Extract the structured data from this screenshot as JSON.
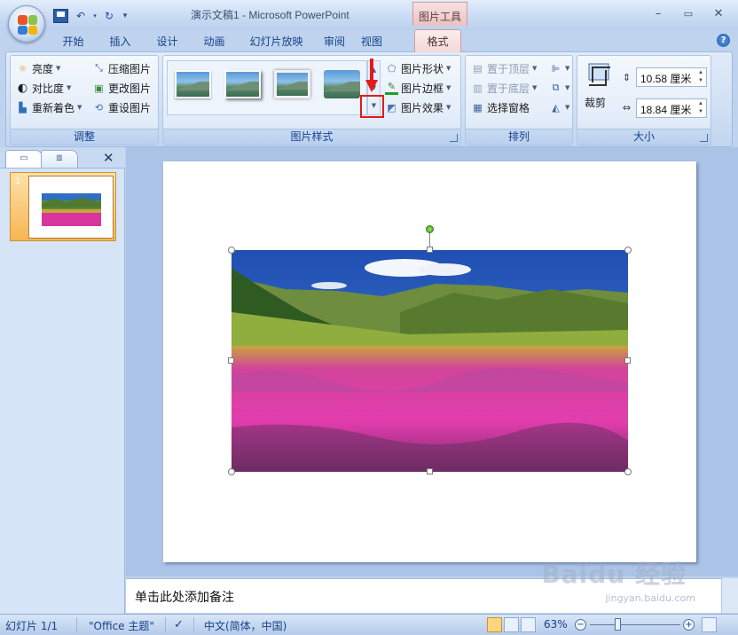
{
  "titlebar": {
    "document_title": "演示文稿1 - Microsoft PowerPoint",
    "contextual_tab": "图片工具",
    "window_controls": [
      "–",
      "▭",
      "✕"
    ]
  },
  "qat": {
    "dropdown": "▾"
  },
  "ribbon_tabs": {
    "items": [
      "开始",
      "插入",
      "设计",
      "动画",
      "幻灯片放映",
      "审阅",
      "视图"
    ],
    "active": "格式"
  },
  "groups": {
    "adjust": {
      "label": "调整",
      "brightness": "亮度",
      "contrast": "对比度",
      "recolor": "重新着色",
      "compress": "压缩图片",
      "change_picture": "更改图片",
      "reset_picture": "重设图片"
    },
    "picture_styles": {
      "label": "图片样式",
      "shape": "图片形状",
      "border": "图片边框",
      "effects": "图片效果"
    },
    "arrange": {
      "label": "排列",
      "bring_front": "置于顶层",
      "send_back": "置于底层",
      "selection_pane": "选择窗格"
    },
    "size": {
      "label": "大小",
      "crop": "裁剪",
      "height": "10.58 厘米",
      "width": "18.84 厘米"
    }
  },
  "slides_pane": {
    "slide_number": "1",
    "close": "✕"
  },
  "notes": {
    "placeholder": "单击此处添加备注"
  },
  "statusbar": {
    "slide_info": "幻灯片 1/1",
    "theme": "\"Office 主题\"",
    "language": "中文(简体，中国)",
    "zoom": "63%"
  },
  "watermark": {
    "brand": "Baidu 经验",
    "url": "jingyan.baidu.com"
  },
  "colors": {
    "highlight_box": "#e11b1b",
    "contextual_tab": "#eac2c2",
    "accent": "#15428b"
  }
}
